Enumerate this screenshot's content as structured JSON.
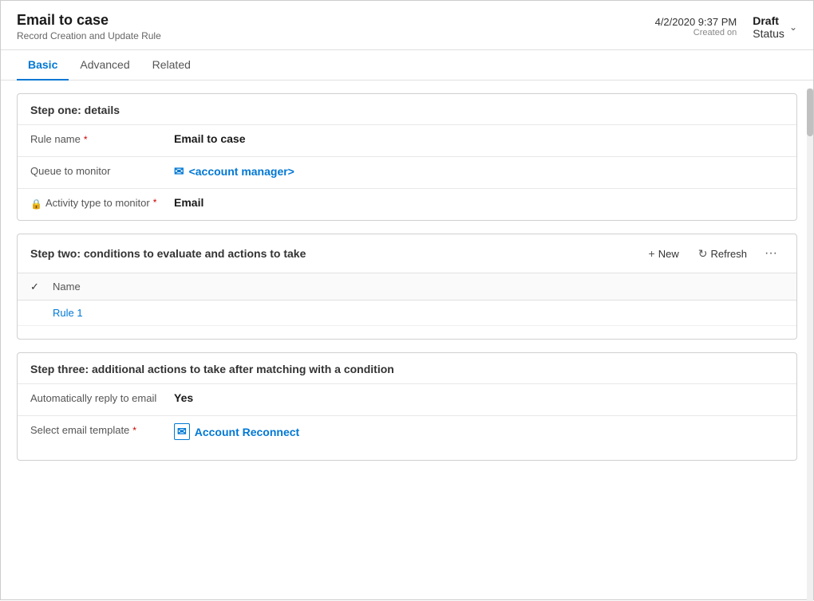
{
  "header": {
    "title": "Email to case",
    "subtitle": "Record Creation and Update Rule",
    "date": "4/2/2020 9:37 PM",
    "date_label": "Created on",
    "status": "Draft",
    "status_label": "Status"
  },
  "tabs": [
    {
      "id": "basic",
      "label": "Basic",
      "active": true
    },
    {
      "id": "advanced",
      "label": "Advanced",
      "active": false
    },
    {
      "id": "related",
      "label": "Related",
      "active": false
    }
  ],
  "step_one": {
    "title": "Step one: details",
    "fields": [
      {
        "label": "Rule name",
        "required": true,
        "value": "Email to case",
        "type": "text"
      },
      {
        "label": "Queue to monitor",
        "required": false,
        "value": "<account manager>",
        "type": "link",
        "icon": "queue"
      },
      {
        "label": "Activity type to monitor",
        "required": true,
        "value": "Email",
        "type": "text",
        "lock": true
      }
    ]
  },
  "step_two": {
    "title": "Step two: conditions to evaluate and actions to take",
    "actions": {
      "new_label": "New",
      "refresh_label": "Refresh",
      "more_icon": "···"
    },
    "table": {
      "columns": [
        "Name"
      ],
      "rows": [
        {
          "name": "Rule 1"
        }
      ]
    }
  },
  "step_three": {
    "title": "Step three: additional actions to take after matching with a condition",
    "fields": [
      {
        "label": "Automatically reply to email",
        "required": false,
        "value": "Yes",
        "type": "text"
      },
      {
        "label": "Select email template",
        "required": true,
        "value": "Account Reconnect",
        "type": "link",
        "icon": "template"
      }
    ]
  }
}
